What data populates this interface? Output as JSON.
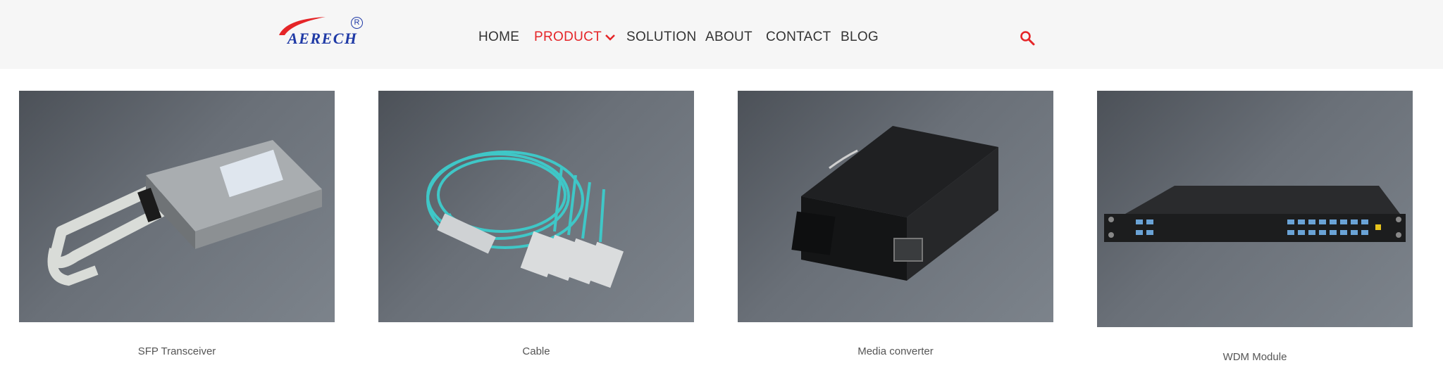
{
  "header": {
    "logo_text": "AERECH",
    "logo_registered": "R",
    "brand_color": "#e52528",
    "logo_color": "#1f3aa6"
  },
  "nav": {
    "items": [
      {
        "label": "HOME"
      },
      {
        "label": "PRODUCT",
        "active": true
      },
      {
        "label": "SOLUTION"
      },
      {
        "label": "ABOUT"
      },
      {
        "label": "CONTACT"
      },
      {
        "label": "BLOG"
      }
    ],
    "search_icon": "search-icon"
  },
  "products": [
    {
      "label": "SFP Transceiver",
      "image": "sfp-transceiver-image"
    },
    {
      "label": "Cable",
      "image": "cable-image"
    },
    {
      "label": "Media converter",
      "image": "media-converter-image"
    },
    {
      "label": "WDM Module",
      "image": "wdm-module-image"
    }
  ]
}
